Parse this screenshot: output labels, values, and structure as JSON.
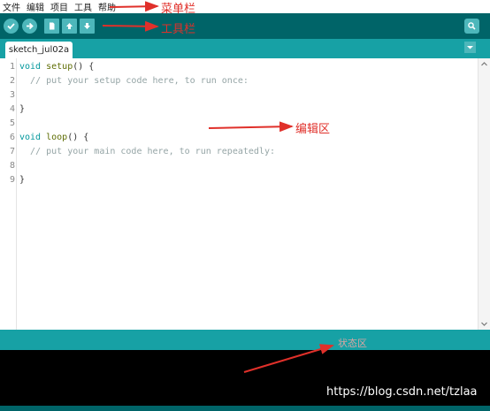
{
  "menubar": {
    "items": [
      "文件",
      "编辑",
      "项目",
      "工具",
      "帮助"
    ]
  },
  "toolbar": {
    "buttons": [
      "verify-icon",
      "upload-icon",
      "new-icon",
      "open-icon",
      "save-icon",
      "serial-monitor-icon"
    ]
  },
  "tabs": [
    {
      "label": "sketch_jul02a"
    }
  ],
  "editor": {
    "line_numbers": [
      "1",
      "2",
      "3",
      "4",
      "5",
      "6",
      "7",
      "8",
      "9"
    ],
    "lines": [
      "void setup() {",
      "  // put your setup code here, to run once:",
      "",
      "}",
      "",
      "void loop() {",
      "  // put your main code here, to run repeatedly:",
      "",
      "}"
    ]
  },
  "annotations": {
    "menubar_label": "菜单栏",
    "toolbar_label": "工具栏",
    "editor_label": "编辑区",
    "console_label": "状态区"
  },
  "watermark": "https://blog.csdn.net/tzlaa",
  "colors": {
    "toolbar_bg": "#006468",
    "tab_bar_bg": "#17a1a5",
    "button_bg": "#4db7bb",
    "console_bg": "#000000",
    "annotation_red": "#e0302a"
  }
}
